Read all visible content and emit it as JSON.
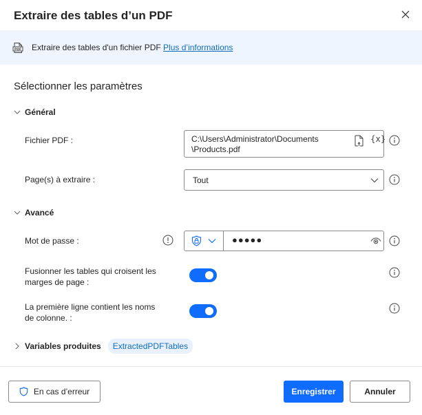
{
  "dialog": {
    "title": "Extraire des tables d’un PDF",
    "close_icon": "close-icon"
  },
  "banner": {
    "icon": "pdf-file-icon",
    "text": "Extraire des tables d'un fichier PDF ",
    "link_label": "Plus d’informations"
  },
  "section_title": "Sélectionner les paramètres",
  "general": {
    "header": "Général",
    "pdf_file": {
      "label": "Fichier PDF :",
      "value": "C:\\Users\\Administrator\\Documents\\Products.pdf",
      "line1": "C:\\Users\\Administrator\\Documents",
      "line2": "\\Products.pdf",
      "variable_icon_text": "{x}"
    },
    "pages": {
      "label": "Page(s) à extraire :",
      "selected": "Tout"
    }
  },
  "advanced": {
    "header": "Avancé",
    "password": {
      "label": "Mot de passe :",
      "masked_value": "●●●●●"
    },
    "merge_tables": {
      "label": "Fusionner les tables qui croisent les marges de page :",
      "enabled": true
    },
    "first_line_headers": {
      "label": "La première ligne contient les noms de colonne. :",
      "enabled": true
    }
  },
  "produced_variables": {
    "header": "Variables produites",
    "items": [
      "ExtractedPDFTables"
    ]
  },
  "footer": {
    "on_error_label": "En cas d’erreur",
    "save_label": "Enregistrer",
    "cancel_label": "Annuler"
  },
  "colors": {
    "accent": "#0f6cff",
    "link": "#0f6cbd",
    "banner_bg": "#eff5fe",
    "pill_bg": "#e8f1fd"
  }
}
